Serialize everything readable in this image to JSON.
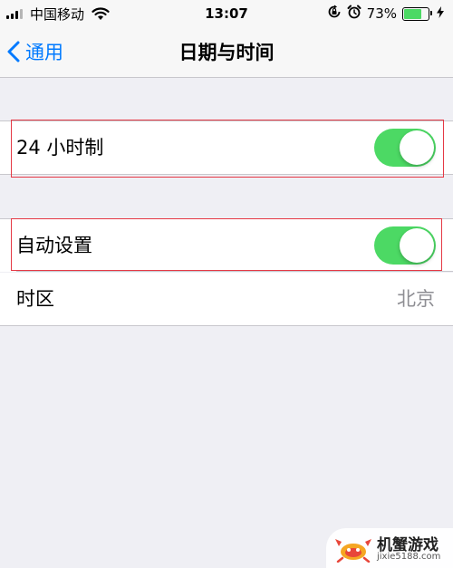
{
  "status_bar": {
    "carrier": "中国移动",
    "time": "13:07",
    "battery_percent": "73%",
    "battery_level": 0.73,
    "icons": [
      "signal-icon",
      "wifi-icon",
      "orientation-lock-icon",
      "alarm-icon",
      "battery-icon",
      "charging-icon"
    ]
  },
  "nav": {
    "back_label": "通用",
    "title": "日期与时间"
  },
  "settings": {
    "hour24": {
      "label": "24 小时制",
      "on": true
    },
    "auto_set": {
      "label": "自动设置",
      "on": true
    },
    "timezone": {
      "label": "时区",
      "value": "北京"
    }
  },
  "watermark": {
    "name": "机蟹游戏",
    "url": "jixie5188.com"
  },
  "colors": {
    "accent": "#007aff",
    "toggle_on": "#4cd964",
    "highlight": "#e53945",
    "background": "#efeff4"
  }
}
